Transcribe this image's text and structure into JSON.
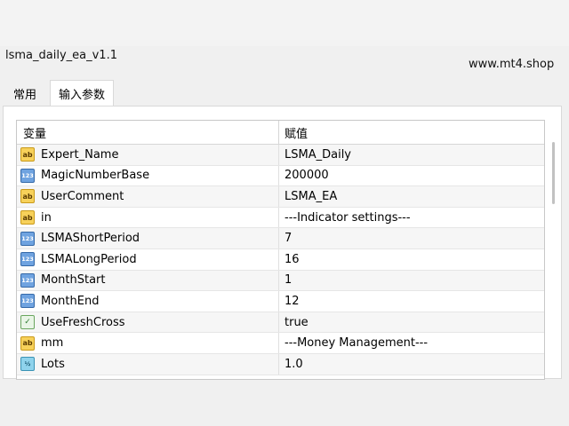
{
  "window": {
    "title": "lsma_daily_ea_v1.1",
    "site": "www.mt4.shop"
  },
  "tabs": [
    {
      "label": "常用",
      "active": false
    },
    {
      "label": "输入参数",
      "active": true
    }
  ],
  "table": {
    "columns": [
      "变量",
      "赋值"
    ],
    "rows": [
      {
        "icon": "ab",
        "name": "Expert_Name",
        "value": "LSMA_Daily"
      },
      {
        "icon": "123",
        "name": "MagicNumberBase",
        "value": "200000"
      },
      {
        "icon": "ab",
        "name": "UserComment",
        "value": "LSMA_EA"
      },
      {
        "icon": "ab",
        "name": "in",
        "value": "---Indicator settings---"
      },
      {
        "icon": "123",
        "name": "LSMAShortPeriod",
        "value": "7"
      },
      {
        "icon": "123",
        "name": "LSMALongPeriod",
        "value": "16"
      },
      {
        "icon": "123",
        "name": "MonthStart",
        "value": "1"
      },
      {
        "icon": "123",
        "name": "MonthEnd",
        "value": "12"
      },
      {
        "icon": "bool",
        "name": "UseFreshCross",
        "value": "true"
      },
      {
        "icon": "ab",
        "name": "mm",
        "value": "---Money Management---"
      },
      {
        "icon": "frac",
        "name": "Lots",
        "value": "1.0"
      }
    ]
  },
  "icon_types": {
    "ab": "string-type-icon",
    "123": "integer-type-icon",
    "bool": "boolean-type-icon",
    "frac": "double-type-icon"
  }
}
